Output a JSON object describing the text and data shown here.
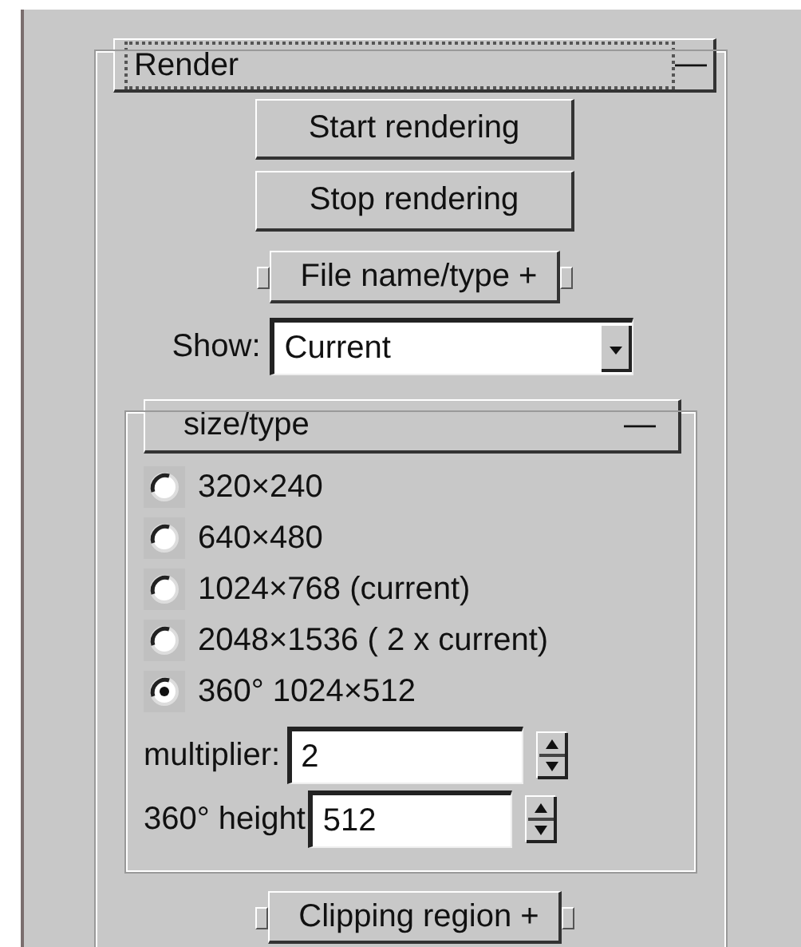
{
  "render_panel": {
    "title": "Render",
    "toggle": "—",
    "focused": true,
    "buttons": [
      "Start rendering",
      "Stop rendering"
    ],
    "file_rollout": {
      "title": "File name/type",
      "toggle": "+"
    },
    "show": {
      "label": "Show:",
      "value": "Current"
    },
    "size_panel": {
      "title": "size/type",
      "toggle": "—",
      "options": [
        {
          "label": "320×240",
          "selected": false
        },
        {
          "label": "640×480",
          "selected": false
        },
        {
          "label": "1024×768 (current)",
          "selected": false
        },
        {
          "label": "2048×1536 ( 2 x current)",
          "selected": false
        },
        {
          "label": "360° 1024×512",
          "selected": true
        }
      ],
      "multiplier": {
        "label": "multiplier:",
        "value": "2"
      },
      "height": {
        "label": "360° height",
        "value": "512"
      }
    },
    "clip_rollout": {
      "title": "Clipping region",
      "toggle": "+"
    }
  }
}
